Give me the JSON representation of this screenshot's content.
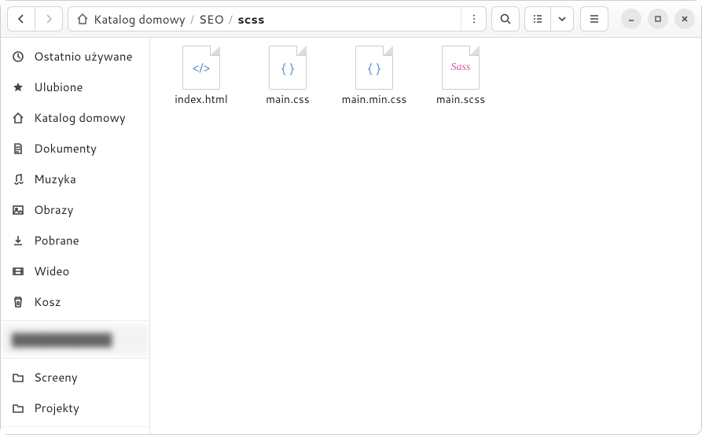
{
  "breadcrumb": {
    "root": "Katalog domowy",
    "mid": "SEO",
    "current": "scss"
  },
  "sidebar": {
    "recent": "Ostatnio używane",
    "favorites": "Ulubione",
    "home": "Katalog domowy",
    "documents": "Dokumenty",
    "music": "Muzyka",
    "pictures": "Obrazy",
    "downloads": "Pobrane",
    "videos": "Wideo",
    "trash": "Kosz",
    "blurred": "████████████",
    "screens": "Screeny",
    "projects": "Projekty"
  },
  "files": [
    {
      "name": "index.html",
      "icon": "</>",
      "cls": "blue"
    },
    {
      "name": "main.css",
      "icon": "{ }",
      "cls": "blue"
    },
    {
      "name": "main.min.css",
      "icon": "{ }",
      "cls": "blue"
    },
    {
      "name": "main.scss",
      "icon": "Sass",
      "cls": "pink"
    }
  ]
}
